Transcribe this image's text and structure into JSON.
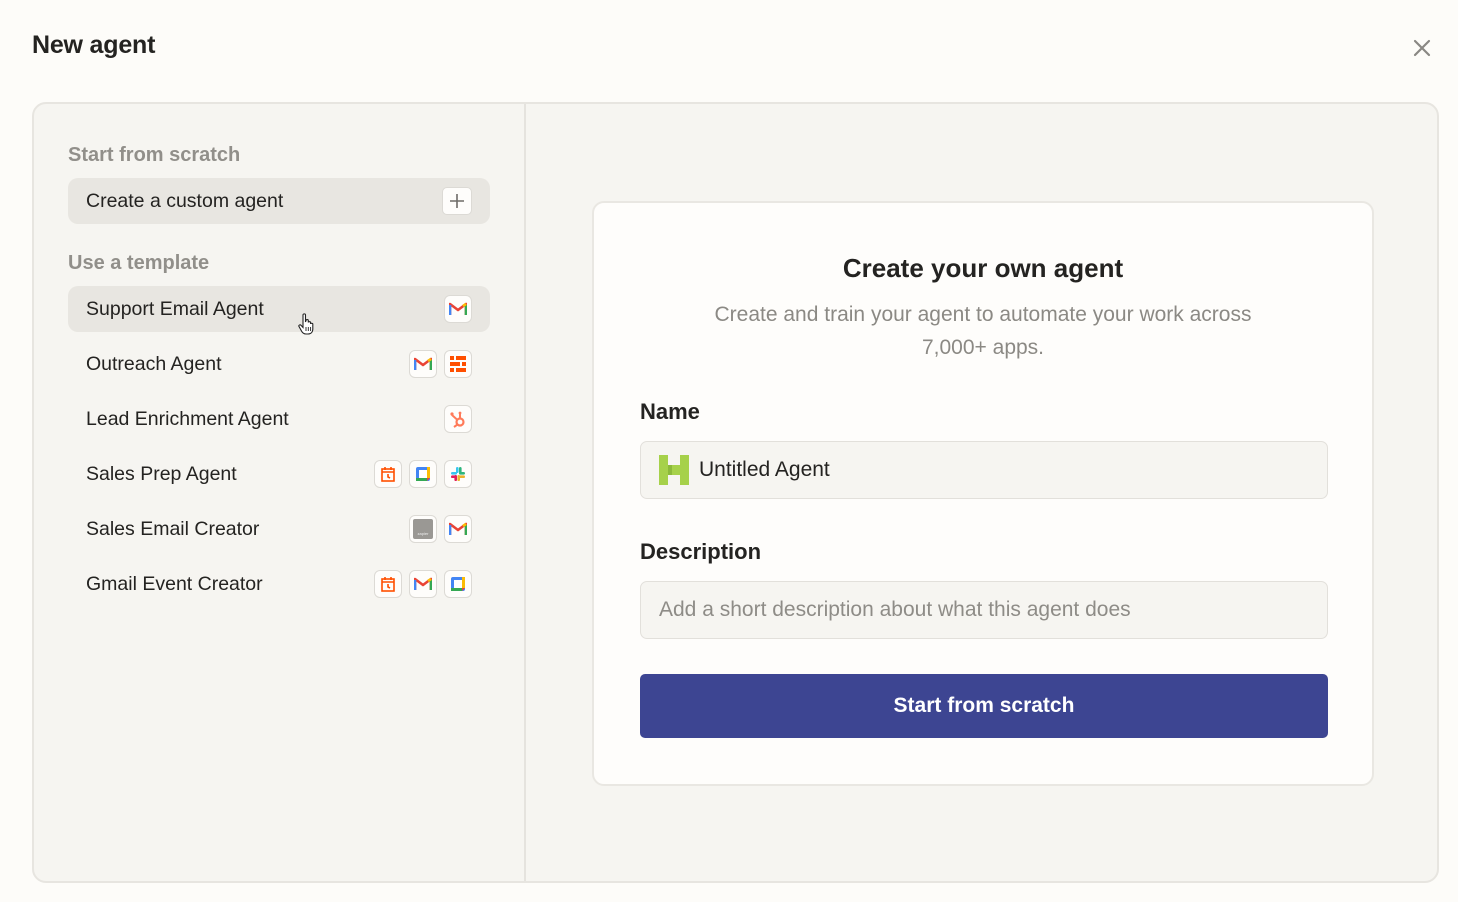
{
  "header": {
    "title": "New agent",
    "close_icon": "close-icon"
  },
  "sidebar": {
    "scratch_section_label": "Start from scratch",
    "create_custom": {
      "label": "Create a custom agent",
      "icon": "plus-icon"
    },
    "template_section_label": "Use a template",
    "templates": [
      {
        "label": "Support Email Agent",
        "icons": [
          "gmail-icon"
        ],
        "active": true
      },
      {
        "label": "Outreach Agent",
        "icons": [
          "gmail-icon",
          "zapier-tables-icon"
        ]
      },
      {
        "label": "Lead Enrichment Agent",
        "icons": [
          "hubspot-icon"
        ]
      },
      {
        "label": "Sales Prep Agent",
        "icons": [
          "schedule-icon",
          "google-calendar-icon",
          "slack-icon"
        ]
      },
      {
        "label": "Sales Email Creator",
        "icons": [
          "zapier-icon",
          "gmail-icon"
        ]
      },
      {
        "label": "Gmail Event Creator",
        "icons": [
          "schedule-icon",
          "gmail-icon",
          "google-calendar-icon"
        ]
      }
    ]
  },
  "main": {
    "card_title": "Create your own agent",
    "card_subtitle": "Create and train your agent to automate your work across 7,000+ apps.",
    "name_label": "Name",
    "name_value": "Untitled Agent",
    "name_icon": "agent-avatar-icon",
    "description_label": "Description",
    "description_placeholder": "Add a short description about what this agent does",
    "description_value": "",
    "submit_label": "Start from scratch"
  },
  "colors": {
    "primary_button": "#3d4592",
    "agent_icon": "#a6d14a",
    "background": "#fdfcf9",
    "panel": "#f6f5f1"
  }
}
